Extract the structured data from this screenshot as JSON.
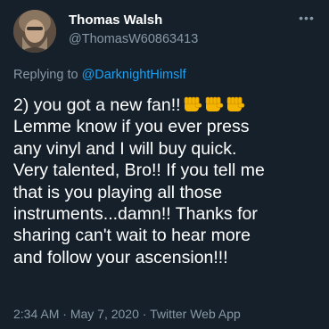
{
  "tweet": {
    "author": {
      "display_name": "Thomas Walsh",
      "handle": "@ThomasW60863413"
    },
    "more_icon": "more-horizontal-icon",
    "reply": {
      "prefix": "Replying to ",
      "mention": "@DarknightHimslf"
    },
    "body_lines": [
      "2) you got a new fan!!",
      "Lemme know if you ever press",
      "any vinyl and I will buy quick.",
      "Very talented, Bro!! If you tell me",
      "that is you playing all those",
      "instruments...damn!! Thanks for",
      "sharing can't wait to hear more",
      "and follow your ascension!!!"
    ],
    "emoji": {
      "name": "oncoming-fist-icon",
      "count": 3,
      "color": "#f4b400"
    },
    "meta": {
      "time": "2:34 AM",
      "separator_1": " · ",
      "date": "May 7, 2020",
      "separator_2": " · ",
      "source": "Twitter Web App"
    }
  },
  "colors": {
    "background": "#15202b",
    "primary_text": "#ffffff",
    "secondary_text": "#8899a6",
    "link": "#1da1f2"
  }
}
